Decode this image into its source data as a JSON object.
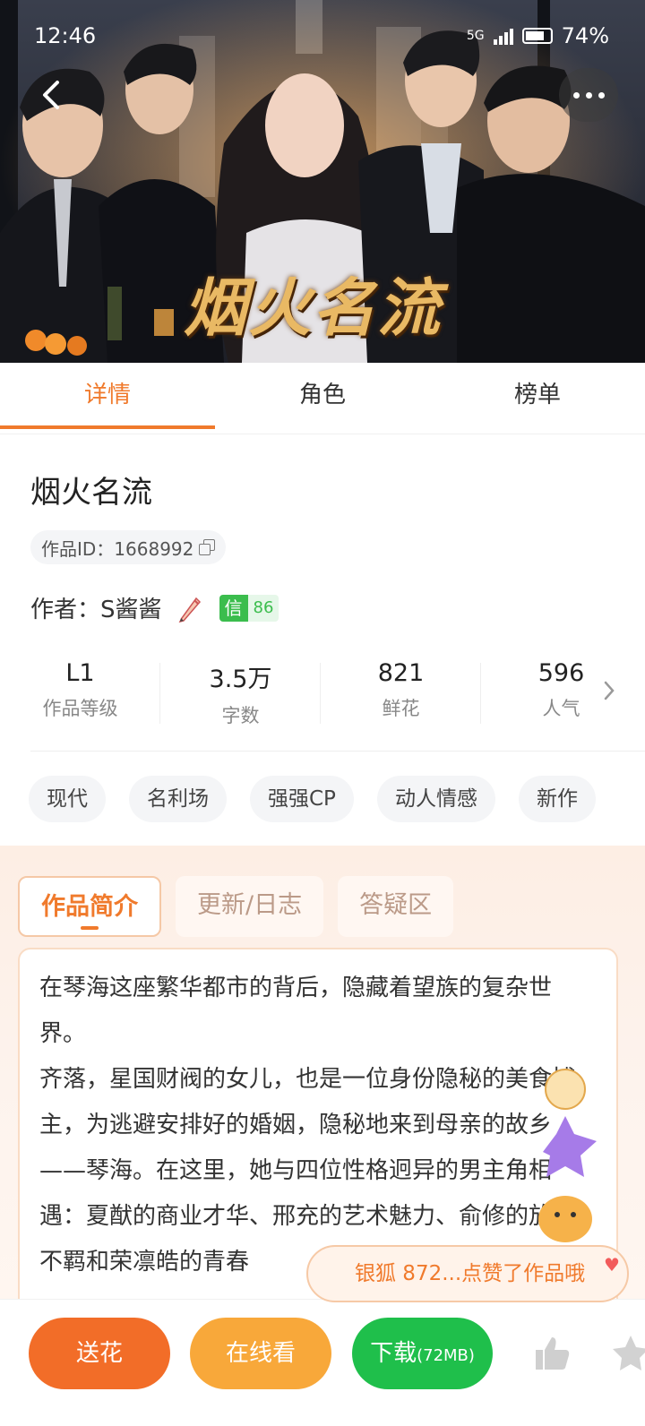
{
  "status": {
    "time": "12:46",
    "battery": "74%",
    "network": "5G"
  },
  "cover": {
    "title_art": "烟火名流"
  },
  "tabs": [
    "详情",
    "角色",
    "榜单"
  ],
  "book": {
    "title": "烟火名流",
    "work_id": "作品ID：1668992",
    "author_label": "作者：",
    "author": "S酱酱",
    "credit_badge": "信",
    "credit_score": "86"
  },
  "stats": [
    {
      "value": "L1",
      "label": "作品等级"
    },
    {
      "value": "3.5万",
      "label": "字数"
    },
    {
      "value": "821",
      "label": "鲜花"
    },
    {
      "value": "596",
      "label": "人气"
    }
  ],
  "tags": [
    "现代",
    "名利场",
    "强强CP",
    "动人情感",
    "新作"
  ],
  "intro_tabs": [
    "作品简介",
    "更新/日志",
    "答疑区"
  ],
  "intro": {
    "p1": "在琴海这座繁华都市的背后，隐藏着望族的复杂世界。",
    "p2": "齐落，星国财阀的女儿，也是一位身份隐秘的美食博主，为逃避安排好的婚姻，隐秘地来到母亲的故乡——琴海。在这里，她与四位性格迥异的男主角相遇：夏猷的商业才华、邢充的艺术魅力、俞修的放浪不羁和荣凛皓的青春"
  },
  "toast": "银狐 872...点赞了作品哦",
  "bottom": {
    "flower": "送花",
    "read": "在线看",
    "download": "下载",
    "download_size": "(72MB)"
  },
  "colors": {
    "accent": "#f07a2c",
    "green": "#1fbf4b",
    "read": "#f8a83a"
  }
}
